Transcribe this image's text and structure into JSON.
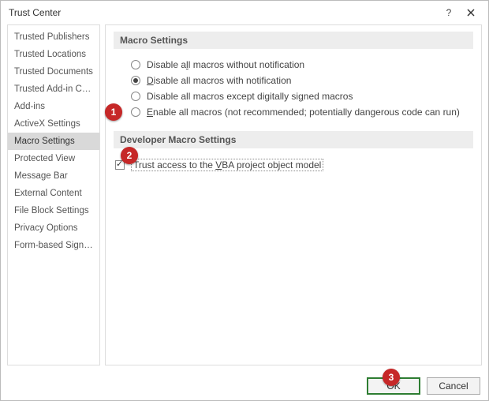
{
  "window": {
    "title": "Trust Center"
  },
  "sidebar": {
    "items": [
      {
        "label": "Trusted Publishers"
      },
      {
        "label": "Trusted Locations"
      },
      {
        "label": "Trusted Documents"
      },
      {
        "label": "Trusted Add-in Catalogs"
      },
      {
        "label": "Add-ins"
      },
      {
        "label": "ActiveX Settings"
      },
      {
        "label": "Macro Settings"
      },
      {
        "label": "Protected View"
      },
      {
        "label": "Message Bar"
      },
      {
        "label": "External Content"
      },
      {
        "label": "File Block Settings"
      },
      {
        "label": "Privacy Options"
      },
      {
        "label": "Form-based Sign-in"
      }
    ],
    "selected_index": 6
  },
  "main": {
    "macro_header": "Macro Settings",
    "radios": [
      {
        "pre": "Disable a",
        "ukey": "l",
        "post": "l macros without notification"
      },
      {
        "pre": "",
        "ukey": "D",
        "post": "isable all macros with notification"
      },
      {
        "pre": "Disable all macros except digitally si",
        "ukey": "g",
        "post": "ned macros"
      },
      {
        "pre": "",
        "ukey": "E",
        "post": "nable all macros (not recommended; potentially dangerous code can run)"
      }
    ],
    "radio_selected_index": 1,
    "dev_header": "Developer Macro Settings",
    "trust_access": {
      "pre": "Trust access to the ",
      "ukey": "V",
      "post": "BA project object model"
    },
    "trust_access_checked": true
  },
  "footer": {
    "ok": "OK",
    "cancel": "Cancel"
  },
  "callouts": {
    "c1": "1",
    "c2": "2",
    "c3": "3"
  }
}
